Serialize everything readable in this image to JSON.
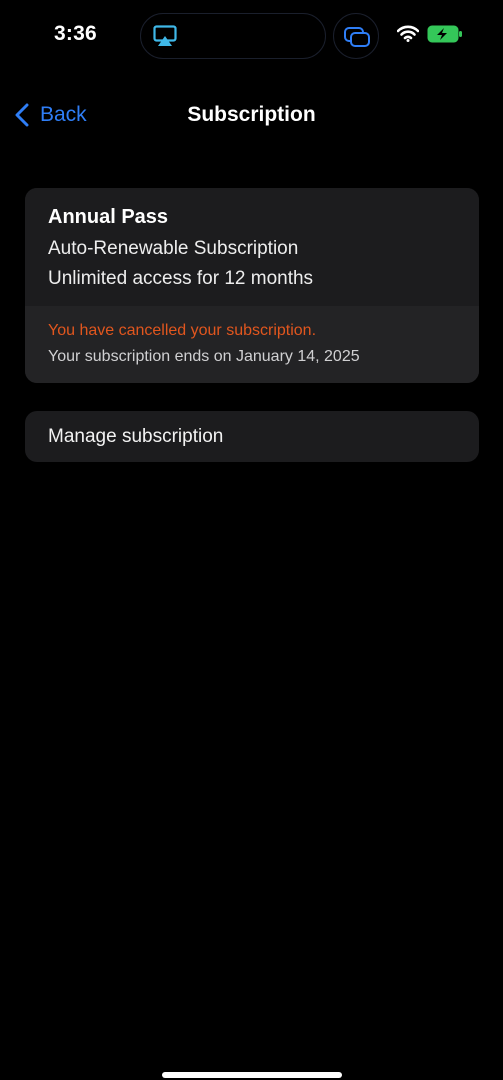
{
  "status_bar": {
    "time": "3:36",
    "icons": [
      "airplay-icon",
      "stacked-windows-icon",
      "wifi-icon",
      "battery-charging-icon"
    ]
  },
  "nav": {
    "back_label": "Back",
    "title": "Subscription"
  },
  "subscription": {
    "plan_name": "Annual Pass",
    "plan_type": "Auto-Renewable Subscription",
    "plan_description": "Unlimited access for 12 months",
    "cancel_notice": "You have cancelled your subscription.",
    "end_date_text": "Your subscription ends on January 14, 2025"
  },
  "manage": {
    "label": "Manage subscription"
  },
  "colors": {
    "background": "#000000",
    "card": "#1c1c1e",
    "accent_blue": "#2f7ef6",
    "warning_orange": "#e1561e",
    "battery_green": "#34c759"
  }
}
